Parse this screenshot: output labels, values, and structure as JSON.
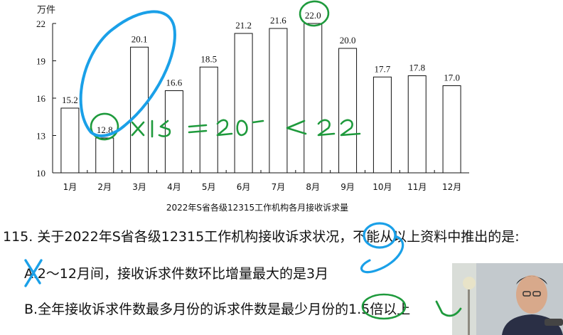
{
  "chart_data": {
    "type": "bar",
    "title": "2022年S省各级12315工作机构各月接收诉求量",
    "unit_label": "万件",
    "categories": [
      "1月",
      "2月",
      "3月",
      "4月",
      "5月",
      "6月",
      "7月",
      "8月",
      "9月",
      "10月",
      "11月",
      "12月"
    ],
    "values": [
      15.2,
      12.8,
      20.1,
      16.6,
      18.5,
      21.2,
      21.6,
      22.0,
      20.0,
      17.7,
      17.8,
      17.0
    ],
    "data_labels": [
      "15.2",
      "12.8",
      "20.1",
      "16.6",
      "18.5",
      "21.2",
      "21.6",
      "22.0",
      "20.0",
      "17.7",
      "17.8",
      "17.0"
    ],
    "ylim": [
      10,
      22
    ],
    "yticks": [
      "10",
      "13",
      "16",
      "19",
      "22"
    ],
    "grid": false,
    "bar_fill": "#ffffff",
    "bar_stroke": "#111111"
  },
  "question": {
    "stem": "115. 关于2022年S省各级12315工作机构接收诉求状况，不能从以上资料中推出的是:",
    "option_a": "A.2～12月间，接收诉求件数环比增量最大的是3月",
    "option_b": "B.全年接收诉求件数最多月份的诉求件数是最少月份的1.5倍以上"
  },
  "annotation_text": "×1.5 = 20⁺ < 22",
  "colors": {
    "green_ink": "#1e9a3c",
    "blue_ink": "#1aa0e8"
  }
}
